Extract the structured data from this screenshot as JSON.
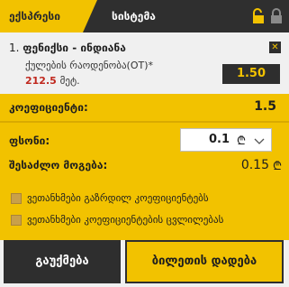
{
  "tabs": {
    "express": "ექსპრესი",
    "system": "სისტემა"
  },
  "icons": {
    "unlock": "unlock-icon",
    "lock": "lock-icon",
    "close": "close-icon",
    "chevron": "chevron-down-icon"
  },
  "selection": {
    "index": "1.",
    "match": "ფენიქსი - ინდიანა",
    "market": "ქულების რაოდენობა(OT)*",
    "line": "212.5",
    "line_unit": "მეტ.",
    "remove_label": "✕",
    "odds": "1.50"
  },
  "summary": {
    "coef_label": "კოეფიციენტი:",
    "coef_value": "1.5",
    "stake_label": "ფსონი:",
    "stake_value": "0.1",
    "currency": "₾",
    "win_label": "შესაძლო მოგება:",
    "win_value": "0.15"
  },
  "options": [
    "ვეთანხმები გაზრდილ კოეფიციენტებს",
    "ვეთანხმები კოეფიციენტების ცვლილებას"
  ],
  "buttons": {
    "clear": "გაუქმება",
    "place": "ბილეთის დადება"
  },
  "colors": {
    "accent": "#f2c200",
    "dark": "#2e2e2e",
    "line_red": "#c0281e"
  }
}
